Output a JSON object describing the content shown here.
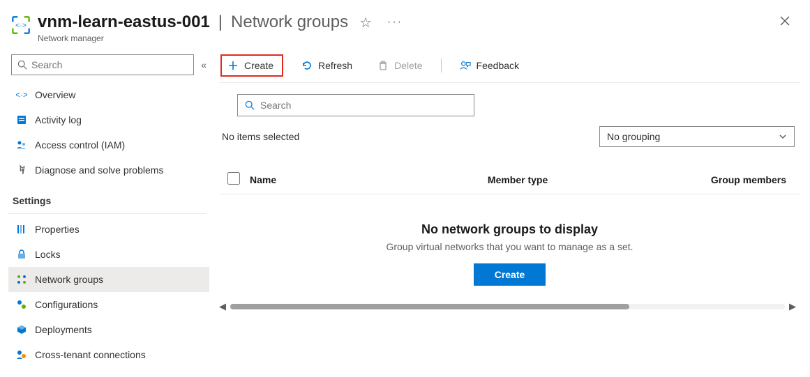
{
  "header": {
    "resource_name": "vnm-learn-eastus-001",
    "page_title": "Network groups",
    "subtitle": "Network manager"
  },
  "sidebar": {
    "search_placeholder": "Search",
    "items_top": [
      {
        "label": "Overview",
        "icon": "overview"
      },
      {
        "label": "Activity log",
        "icon": "activity-log"
      },
      {
        "label": "Access control (IAM)",
        "icon": "access-control"
      },
      {
        "label": "Diagnose and solve problems",
        "icon": "diagnose"
      }
    ],
    "section_settings_label": "Settings",
    "items_settings": [
      {
        "label": "Properties",
        "icon": "properties"
      },
      {
        "label": "Locks",
        "icon": "locks"
      },
      {
        "label": "Network groups",
        "icon": "network-groups",
        "active": true
      },
      {
        "label": "Configurations",
        "icon": "configurations"
      },
      {
        "label": "Deployments",
        "icon": "deployments"
      },
      {
        "label": "Cross-tenant connections",
        "icon": "cross-tenant"
      }
    ]
  },
  "toolbar": {
    "create_label": "Create",
    "refresh_label": "Refresh",
    "delete_label": "Delete",
    "feedback_label": "Feedback"
  },
  "content": {
    "search_placeholder": "Search",
    "status_text": "No items selected",
    "grouping_select": "No grouping",
    "columns": {
      "name": "Name",
      "member_type": "Member type",
      "group_members": "Group members"
    },
    "empty": {
      "title": "No network groups to display",
      "desc": "Group virtual networks that you want to manage as a set.",
      "button": "Create"
    }
  }
}
